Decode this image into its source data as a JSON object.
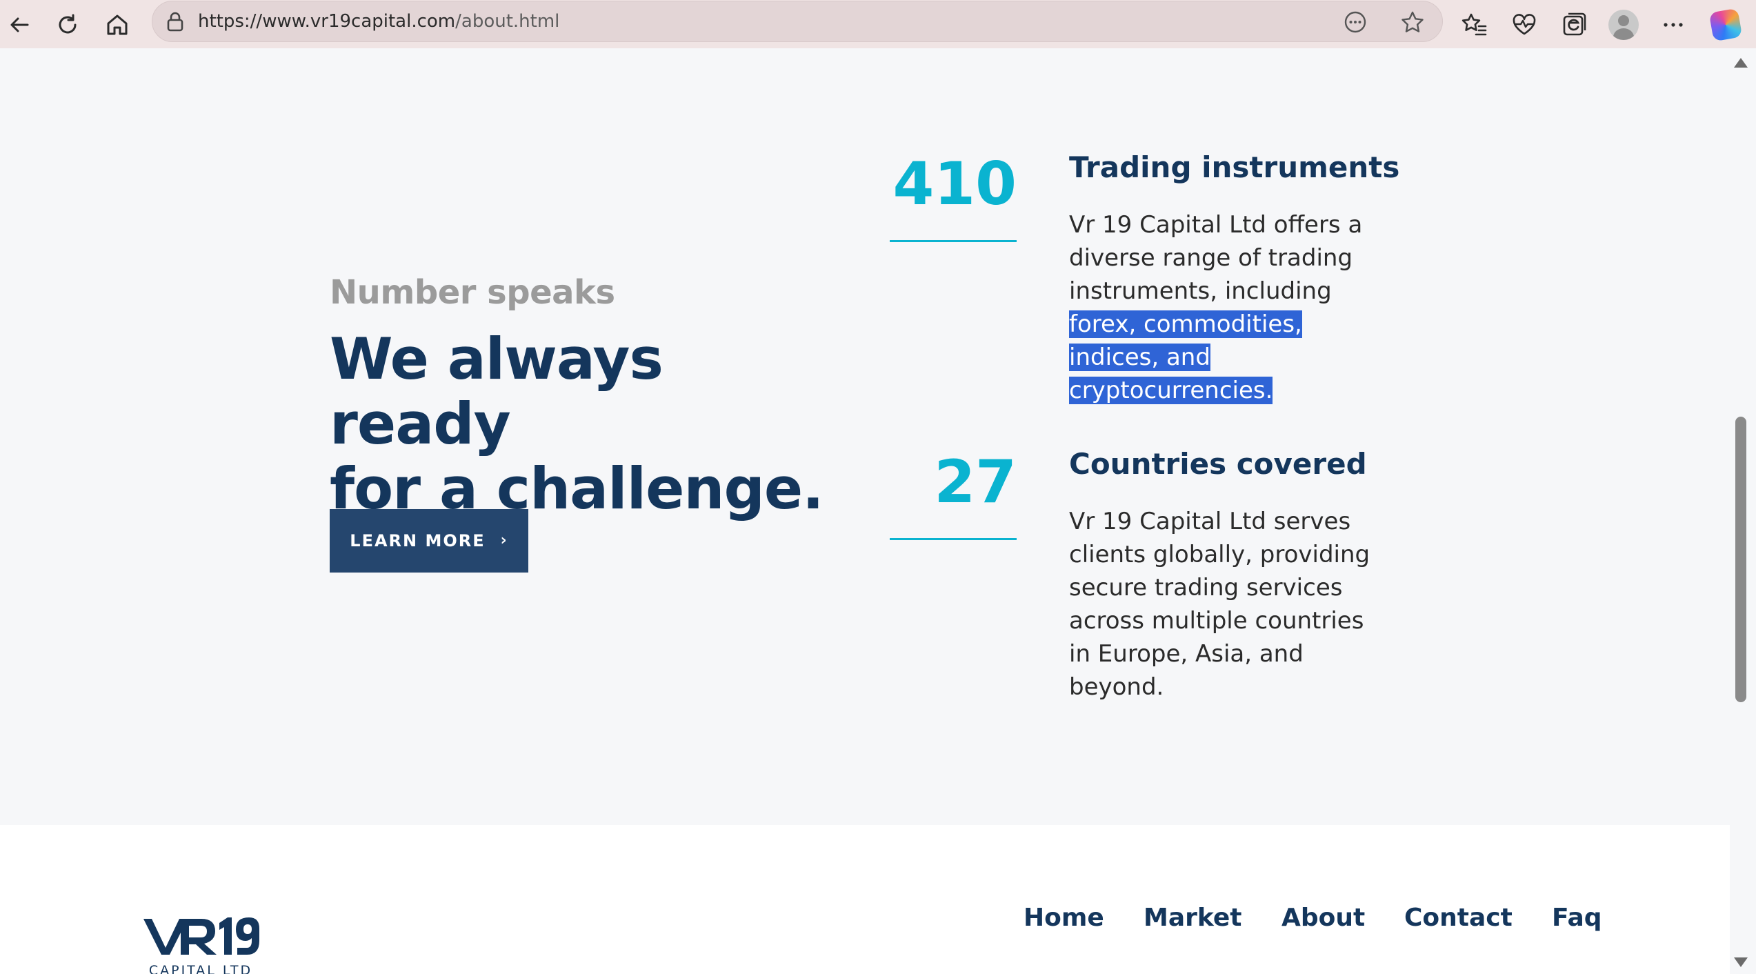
{
  "browser": {
    "url_host": "https://www.vr19capital.com",
    "url_path": "/about.html"
  },
  "hero": {
    "eyebrow": "Number speaks",
    "headline_line1": "We always ready",
    "headline_line2": "for a challenge.",
    "button_label": "LEARN MORE",
    "button_chevron": "›"
  },
  "stats": [
    {
      "number": "410",
      "title": "Trading instruments",
      "body_plain": "Vr 19 Capital Ltd offers a diverse range of trading instruments, including",
      "body_selected": " forex, commodities, indices, and cryptocurrencies."
    },
    {
      "number": "27",
      "title": "Countries covered",
      "body_plain": "Vr 19 Capital Ltd serves clients globally, providing secure trading services across multiple countries in Europe, Asia, and beyond."
    }
  ],
  "footer": {
    "logo_mark": "VR19",
    "logo_sub": "CAPITAL LTD",
    "nav": [
      "Home",
      "Market",
      "About",
      "Contact",
      "Faq"
    ]
  },
  "colors": {
    "navy": "#14365c",
    "accent_cyan": "#0ab3d0",
    "button": "#25466e",
    "selection": "#2f64d6"
  }
}
